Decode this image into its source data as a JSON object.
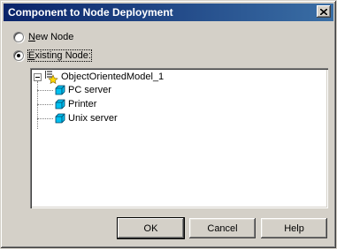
{
  "window": {
    "title": "Component to Node Deployment"
  },
  "options": {
    "new_node": {
      "prefix": "",
      "accel": "N",
      "rest": "ew Node",
      "checked": false
    },
    "existing_node": {
      "prefix": "",
      "accel": "E",
      "rest": "xisting Node:",
      "checked": true
    }
  },
  "tree": {
    "root": {
      "label": "ObjectOrientedModel_1",
      "icon": "model-icon",
      "expanded": true
    },
    "children": [
      {
        "label": "PC server",
        "icon": "node-cube-icon"
      },
      {
        "label": "Printer",
        "icon": "node-cube-icon"
      },
      {
        "label": "Unix server",
        "icon": "node-cube-icon"
      }
    ]
  },
  "buttons": {
    "ok": "OK",
    "cancel": "Cancel",
    "help": "Help"
  },
  "colors": {
    "titlebar": "#0a246a",
    "face": "#d4d0c8",
    "node_icon": "#00c0f0"
  }
}
